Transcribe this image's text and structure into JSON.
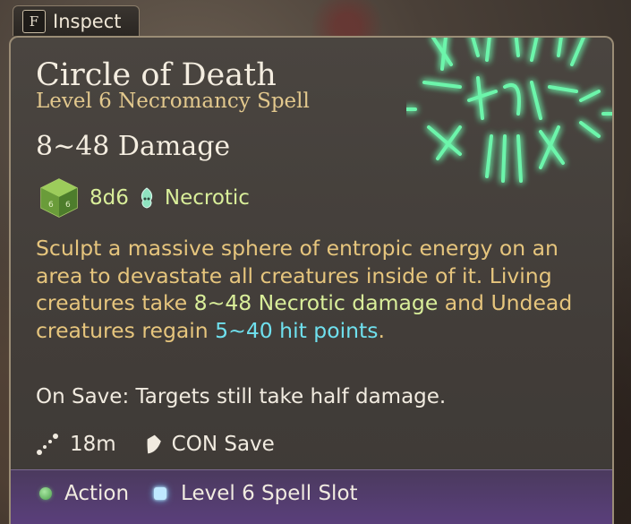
{
  "inspect": {
    "key": "F",
    "label": "Inspect"
  },
  "spell": {
    "name": "Circle of Death",
    "subtitle": "Level 6 Necromancy Spell",
    "damage": "8~48 Damage",
    "dice": "8d6",
    "damage_type": "Necrotic",
    "description": {
      "part1": "Sculpt a massive sphere of entropic energy on an area to devastate all creatures inside of it. Living creatures take ",
      "highlight_damage": "8~48 Necrotic damage",
      "part2": " and Undead creatures regain ",
      "highlight_heal": "5~40 hit points",
      "part3": "."
    },
    "on_save": "On Save: Targets still take half damage.",
    "range": "18m",
    "save": "CON Save"
  },
  "costs": {
    "action": "Action",
    "spell_slot": "Level 6 Spell Slot"
  },
  "colors": {
    "title": "#f4ede0",
    "subtitle": "#e2c88d",
    "necrotic_green": "#d9ee9a",
    "heal_cyan": "#6fe0ee",
    "spell_icon_glow": "#5ef2a0",
    "footer_purple": "#5a3f7b"
  },
  "icons": {
    "spell_icon": "circle-of-death-spell-icon",
    "dice": "d6-dice-icon",
    "necrotic": "necrotic-skull-icon",
    "range": "range-icon",
    "save": "shield-icon",
    "action": "action-dot-icon",
    "spell_slot": "spell-slot-icon"
  }
}
